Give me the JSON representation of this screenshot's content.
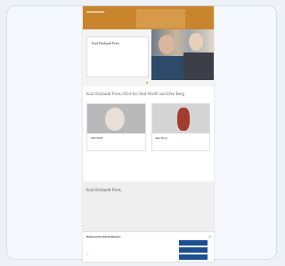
{
  "header": {
    "logo": "",
    "nav": ""
  },
  "hero": {
    "title": "Karl Ehrhardt Preis",
    "text": ""
  },
  "section_title": "Karl Ehrhardt Preis 2024 für Olaf Wolff und Elke Berg",
  "profiles": [
    {
      "name": "Olaf Wolff",
      "sub": ""
    },
    {
      "name": "Elke Berg",
      "sub": ""
    }
  ],
  "links": {
    "line1": "",
    "line2": ""
  },
  "about": {
    "title": "Karl Ehrhardt Preis",
    "subtitle": "",
    "text": ""
  },
  "cookie": {
    "title": "Datenschutz-Einstellungen",
    "text": "",
    "btn1": "",
    "btn2": "",
    "btn3": "",
    "close": "×"
  }
}
